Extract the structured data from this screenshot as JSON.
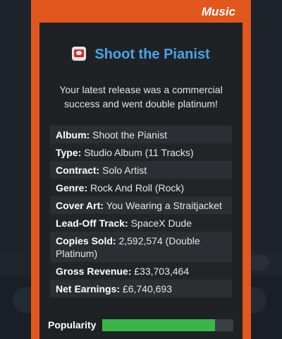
{
  "modal": {
    "tag": "Music",
    "title": "Shoot the Pianist",
    "message": "Your latest release was a commercial success and went double platinum!",
    "details": [
      {
        "label": "Album:",
        "value": "Shoot the Pianist"
      },
      {
        "label": "Type:",
        "value": "Studio Album (11 Tracks)"
      },
      {
        "label": "Contract:",
        "value": "Solo Artist"
      },
      {
        "label": "Genre:",
        "value": "Rock And Roll (Rock)"
      },
      {
        "label": "Cover Art:",
        "value": "You Wearing a Straitjacket"
      },
      {
        "label": "Lead-Off Track:",
        "value": "SpaceX Dude"
      },
      {
        "label": "Copies Sold:",
        "value": "2,592,574 (Double Platinum)"
      },
      {
        "label": "Gross Revenue:",
        "value": "£33,703,464"
      },
      {
        "label": "Net Earnings:",
        "value": "£6,740,693"
      }
    ],
    "popularity": {
      "label": "Popularity",
      "fraction": 0.86
    }
  },
  "colors": {
    "accent": "#e2571e",
    "title": "#4aa3e8",
    "bar": "#3bb54a",
    "panel": "#1f2225"
  },
  "icons": {
    "title_icon": "film-camera-icon"
  }
}
